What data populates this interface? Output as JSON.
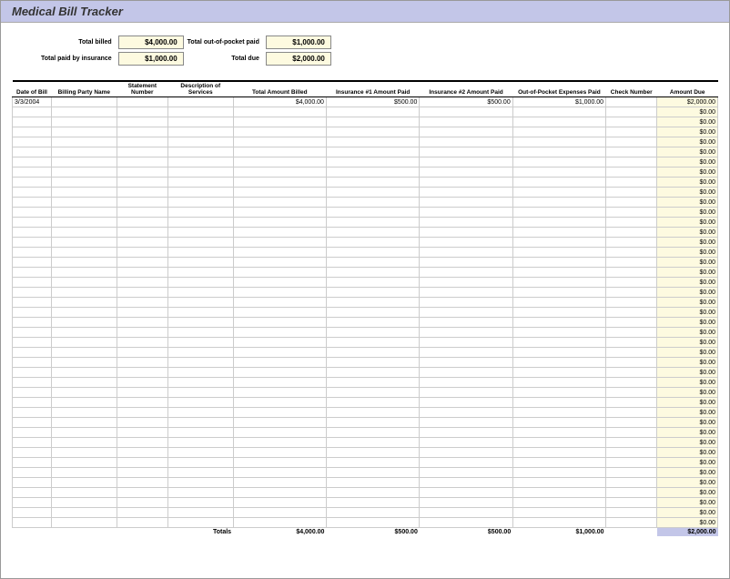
{
  "title": "Medical Bill Tracker",
  "summary": {
    "total_billed_label": "Total billed",
    "total_billed": "$4,000.00",
    "total_oop_label": "Total out-of-pocket paid",
    "total_oop": "$1,000.00",
    "total_insurance_label": "Total paid by insurance",
    "total_insurance": "$1,000.00",
    "total_due_label": "Total due",
    "total_due": "$2,000.00"
  },
  "columns": {
    "date": "Date of Bill",
    "party": "Billing Party Name",
    "stmt": "Statement Number",
    "desc": "Description of Services",
    "billed": "Total Amount Billed",
    "ins1": "Insurance #1 Amount Paid",
    "ins2": "Insurance #2 Amount Paid",
    "oop": "Out-of-Pocket Expenses Paid",
    "check": "Check Number",
    "due": "Amount Due"
  },
  "rows": [
    {
      "date": "3/3/2004",
      "party": "",
      "stmt": "",
      "desc": "",
      "billed": "$4,000.00",
      "ins1": "$500.00",
      "ins2": "$500.00",
      "oop": "$1,000.00",
      "check": "",
      "due": "$2,000.00"
    },
    {
      "date": "",
      "party": "",
      "stmt": "",
      "desc": "",
      "billed": "",
      "ins1": "",
      "ins2": "",
      "oop": "",
      "check": "",
      "due": "$0.00"
    },
    {
      "date": "",
      "party": "",
      "stmt": "",
      "desc": "",
      "billed": "",
      "ins1": "",
      "ins2": "",
      "oop": "",
      "check": "",
      "due": "$0.00"
    },
    {
      "date": "",
      "party": "",
      "stmt": "",
      "desc": "",
      "billed": "",
      "ins1": "",
      "ins2": "",
      "oop": "",
      "check": "",
      "due": "$0.00"
    },
    {
      "date": "",
      "party": "",
      "stmt": "",
      "desc": "",
      "billed": "",
      "ins1": "",
      "ins2": "",
      "oop": "",
      "check": "",
      "due": "$0.00"
    },
    {
      "date": "",
      "party": "",
      "stmt": "",
      "desc": "",
      "billed": "",
      "ins1": "",
      "ins2": "",
      "oop": "",
      "check": "",
      "due": "$0.00"
    },
    {
      "date": "",
      "party": "",
      "stmt": "",
      "desc": "",
      "billed": "",
      "ins1": "",
      "ins2": "",
      "oop": "",
      "check": "",
      "due": "$0.00"
    },
    {
      "date": "",
      "party": "",
      "stmt": "",
      "desc": "",
      "billed": "",
      "ins1": "",
      "ins2": "",
      "oop": "",
      "check": "",
      "due": "$0.00"
    },
    {
      "date": "",
      "party": "",
      "stmt": "",
      "desc": "",
      "billed": "",
      "ins1": "",
      "ins2": "",
      "oop": "",
      "check": "",
      "due": "$0.00"
    },
    {
      "date": "",
      "party": "",
      "stmt": "",
      "desc": "",
      "billed": "",
      "ins1": "",
      "ins2": "",
      "oop": "",
      "check": "",
      "due": "$0.00"
    },
    {
      "date": "",
      "party": "",
      "stmt": "",
      "desc": "",
      "billed": "",
      "ins1": "",
      "ins2": "",
      "oop": "",
      "check": "",
      "due": "$0.00"
    },
    {
      "date": "",
      "party": "",
      "stmt": "",
      "desc": "",
      "billed": "",
      "ins1": "",
      "ins2": "",
      "oop": "",
      "check": "",
      "due": "$0.00"
    },
    {
      "date": "",
      "party": "",
      "stmt": "",
      "desc": "",
      "billed": "",
      "ins1": "",
      "ins2": "",
      "oop": "",
      "check": "",
      "due": "$0.00"
    },
    {
      "date": "",
      "party": "",
      "stmt": "",
      "desc": "",
      "billed": "",
      "ins1": "",
      "ins2": "",
      "oop": "",
      "check": "",
      "due": "$0.00"
    },
    {
      "date": "",
      "party": "",
      "stmt": "",
      "desc": "",
      "billed": "",
      "ins1": "",
      "ins2": "",
      "oop": "",
      "check": "",
      "due": "$0.00"
    },
    {
      "date": "",
      "party": "",
      "stmt": "",
      "desc": "",
      "billed": "",
      "ins1": "",
      "ins2": "",
      "oop": "",
      "check": "",
      "due": "$0.00"
    },
    {
      "date": "",
      "party": "",
      "stmt": "",
      "desc": "",
      "billed": "",
      "ins1": "",
      "ins2": "",
      "oop": "",
      "check": "",
      "due": "$0.00"
    },
    {
      "date": "",
      "party": "",
      "stmt": "",
      "desc": "",
      "billed": "",
      "ins1": "",
      "ins2": "",
      "oop": "",
      "check": "",
      "due": "$0.00"
    },
    {
      "date": "",
      "party": "",
      "stmt": "",
      "desc": "",
      "billed": "",
      "ins1": "",
      "ins2": "",
      "oop": "",
      "check": "",
      "due": "$0.00"
    },
    {
      "date": "",
      "party": "",
      "stmt": "",
      "desc": "",
      "billed": "",
      "ins1": "",
      "ins2": "",
      "oop": "",
      "check": "",
      "due": "$0.00"
    },
    {
      "date": "",
      "party": "",
      "stmt": "",
      "desc": "",
      "billed": "",
      "ins1": "",
      "ins2": "",
      "oop": "",
      "check": "",
      "due": "$0.00"
    },
    {
      "date": "",
      "party": "",
      "stmt": "",
      "desc": "",
      "billed": "",
      "ins1": "",
      "ins2": "",
      "oop": "",
      "check": "",
      "due": "$0.00"
    },
    {
      "date": "",
      "party": "",
      "stmt": "",
      "desc": "",
      "billed": "",
      "ins1": "",
      "ins2": "",
      "oop": "",
      "check": "",
      "due": "$0.00"
    },
    {
      "date": "",
      "party": "",
      "stmt": "",
      "desc": "",
      "billed": "",
      "ins1": "",
      "ins2": "",
      "oop": "",
      "check": "",
      "due": "$0.00"
    },
    {
      "date": "",
      "party": "",
      "stmt": "",
      "desc": "",
      "billed": "",
      "ins1": "",
      "ins2": "",
      "oop": "",
      "check": "",
      "due": "$0.00"
    },
    {
      "date": "",
      "party": "",
      "stmt": "",
      "desc": "",
      "billed": "",
      "ins1": "",
      "ins2": "",
      "oop": "",
      "check": "",
      "due": "$0.00"
    },
    {
      "date": "",
      "party": "",
      "stmt": "",
      "desc": "",
      "billed": "",
      "ins1": "",
      "ins2": "",
      "oop": "",
      "check": "",
      "due": "$0.00"
    },
    {
      "date": "",
      "party": "",
      "stmt": "",
      "desc": "",
      "billed": "",
      "ins1": "",
      "ins2": "",
      "oop": "",
      "check": "",
      "due": "$0.00"
    },
    {
      "date": "",
      "party": "",
      "stmt": "",
      "desc": "",
      "billed": "",
      "ins1": "",
      "ins2": "",
      "oop": "",
      "check": "",
      "due": "$0.00"
    },
    {
      "date": "",
      "party": "",
      "stmt": "",
      "desc": "",
      "billed": "",
      "ins1": "",
      "ins2": "",
      "oop": "",
      "check": "",
      "due": "$0.00"
    },
    {
      "date": "",
      "party": "",
      "stmt": "",
      "desc": "",
      "billed": "",
      "ins1": "",
      "ins2": "",
      "oop": "",
      "check": "",
      "due": "$0.00"
    },
    {
      "date": "",
      "party": "",
      "stmt": "",
      "desc": "",
      "billed": "",
      "ins1": "",
      "ins2": "",
      "oop": "",
      "check": "",
      "due": "$0.00"
    },
    {
      "date": "",
      "party": "",
      "stmt": "",
      "desc": "",
      "billed": "",
      "ins1": "",
      "ins2": "",
      "oop": "",
      "check": "",
      "due": "$0.00"
    },
    {
      "date": "",
      "party": "",
      "stmt": "",
      "desc": "",
      "billed": "",
      "ins1": "",
      "ins2": "",
      "oop": "",
      "check": "",
      "due": "$0.00"
    },
    {
      "date": "",
      "party": "",
      "stmt": "",
      "desc": "",
      "billed": "",
      "ins1": "",
      "ins2": "",
      "oop": "",
      "check": "",
      "due": "$0.00"
    },
    {
      "date": "",
      "party": "",
      "stmt": "",
      "desc": "",
      "billed": "",
      "ins1": "",
      "ins2": "",
      "oop": "",
      "check": "",
      "due": "$0.00"
    },
    {
      "date": "",
      "party": "",
      "stmt": "",
      "desc": "",
      "billed": "",
      "ins1": "",
      "ins2": "",
      "oop": "",
      "check": "",
      "due": "$0.00"
    },
    {
      "date": "",
      "party": "",
      "stmt": "",
      "desc": "",
      "billed": "",
      "ins1": "",
      "ins2": "",
      "oop": "",
      "check": "",
      "due": "$0.00"
    },
    {
      "date": "",
      "party": "",
      "stmt": "",
      "desc": "",
      "billed": "",
      "ins1": "",
      "ins2": "",
      "oop": "",
      "check": "",
      "due": "$0.00"
    },
    {
      "date": "",
      "party": "",
      "stmt": "",
      "desc": "",
      "billed": "",
      "ins1": "",
      "ins2": "",
      "oop": "",
      "check": "",
      "due": "$0.00"
    },
    {
      "date": "",
      "party": "",
      "stmt": "",
      "desc": "",
      "billed": "",
      "ins1": "",
      "ins2": "",
      "oop": "",
      "check": "",
      "due": "$0.00"
    },
    {
      "date": "",
      "party": "",
      "stmt": "",
      "desc": "",
      "billed": "",
      "ins1": "",
      "ins2": "",
      "oop": "",
      "check": "",
      "due": "$0.00"
    },
    {
      "date": "",
      "party": "",
      "stmt": "",
      "desc": "",
      "billed": "",
      "ins1": "",
      "ins2": "",
      "oop": "",
      "check": "",
      "due": "$0.00"
    }
  ],
  "totals": {
    "label": "Totals",
    "billed": "$4,000.00",
    "ins1": "$500.00",
    "ins2": "$500.00",
    "oop": "$1,000.00",
    "due": "$2,000.00"
  }
}
